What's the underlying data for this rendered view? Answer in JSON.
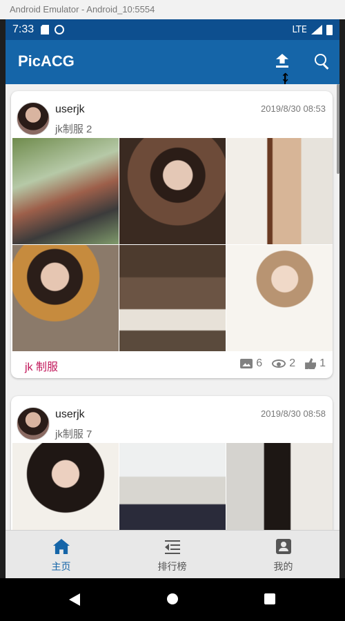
{
  "window": {
    "title": "Android Emulator - Android_10:5554"
  },
  "statusbar": {
    "time": "7:33",
    "network": "LTE",
    "icons": [
      "sd-card-icon",
      "sync-icon",
      "signal-icon",
      "battery-icon"
    ]
  },
  "appbar": {
    "title": "PicACG",
    "actions": [
      "upload-icon",
      "search-icon"
    ]
  },
  "posts": [
    {
      "username": "userjk",
      "title": "jk制服 2",
      "time": "2019/8/30 08:53",
      "tag": "jk 制服",
      "image_count": "6",
      "views": "2",
      "likes": "1"
    },
    {
      "username": "userjk",
      "title": "jk制服 7",
      "time": "2019/8/30 08:58"
    }
  ],
  "bottom_nav": {
    "items": [
      {
        "label": "主页",
        "icon": "home-icon",
        "active": true
      },
      {
        "label": "排行榜",
        "icon": "ranking-icon",
        "active": false
      },
      {
        "label": "我的",
        "icon": "profile-icon",
        "active": false
      }
    ]
  },
  "colors": {
    "primary": "#1565a8",
    "statusbar": "#0d4f8f",
    "tag": "#c2185b"
  }
}
